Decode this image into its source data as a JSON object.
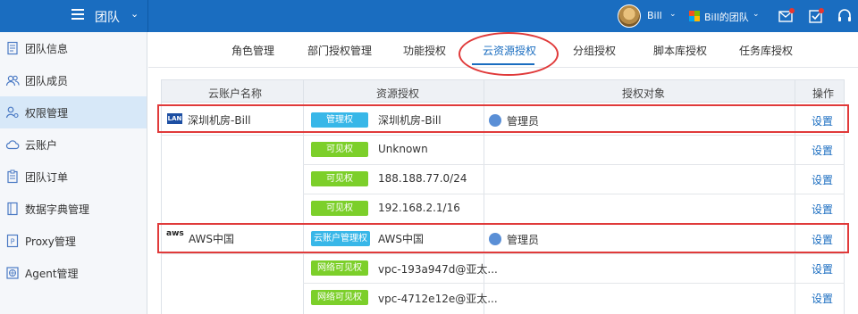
{
  "topbar": {
    "title": "团队",
    "user_name": "Bill",
    "team_name": "Bill的团队",
    "caret": "⌄",
    "icons": [
      "menu-icon",
      "mail-icon",
      "task-icon",
      "headset-icon"
    ]
  },
  "sidebar": {
    "items": [
      {
        "label": "团队信息",
        "icon": "document-icon",
        "active": false
      },
      {
        "label": "团队成员",
        "icon": "users-icon",
        "active": false
      },
      {
        "label": "权限管理",
        "icon": "user-key-icon",
        "active": true
      },
      {
        "label": "云账户",
        "icon": "cloud-icon",
        "active": false
      },
      {
        "label": "团队订单",
        "icon": "clipboard-icon",
        "active": false
      },
      {
        "label": "数据字典管理",
        "icon": "book-icon",
        "active": false
      },
      {
        "label": "Proxy管理",
        "icon": "proxy-icon",
        "active": false
      },
      {
        "label": "Agent管理",
        "icon": "globe-icon",
        "active": false
      }
    ]
  },
  "tabs": [
    {
      "label": "角色管理",
      "active": false
    },
    {
      "label": "部门授权管理",
      "active": false
    },
    {
      "label": "功能授权",
      "active": false
    },
    {
      "label": "云资源授权",
      "active": true
    },
    {
      "label": "分组授权",
      "active": false
    },
    {
      "label": "脚本库授权",
      "active": false
    },
    {
      "label": "任务库授权",
      "active": false
    }
  ],
  "table": {
    "headers": [
      "云账户名称",
      "资源授权",
      "授权对象",
      "操作"
    ],
    "rows": [
      {
        "account": "深圳机房-Bill",
        "account_logo": "LAN",
        "badge": "管理权",
        "badge_color": "#38b7e8",
        "resource": "深圳机房-Bill",
        "target": "管理员",
        "action": "设置"
      },
      {
        "account": "",
        "badge": "可见权",
        "badge_color": "#7ccf2a",
        "resource": "Unknown",
        "target": "",
        "action": "设置"
      },
      {
        "account": "",
        "badge": "可见权",
        "badge_color": "#7ccf2a",
        "resource": "188.188.77.0/24",
        "target": "",
        "action": "设置"
      },
      {
        "account": "",
        "badge": "可见权",
        "badge_color": "#7ccf2a",
        "resource": "192.168.2.1/16",
        "target": "",
        "action": "设置"
      },
      {
        "account": "AWS中国",
        "account_logo": "aws",
        "badge": "云账户管理权",
        "badge_color": "#38b7e8",
        "resource": "AWS中国",
        "target": "管理员",
        "action": "设置"
      },
      {
        "account": "",
        "badge": "网络可见权",
        "badge_color": "#7ccf2a",
        "resource": "vpc-193a947d@亚太...",
        "target": "",
        "action": "设置"
      },
      {
        "account": "",
        "badge": "网络可见权",
        "badge_color": "#7ccf2a",
        "resource": "vpc-4712e12e@亚太...",
        "target": "",
        "action": "设置"
      }
    ]
  }
}
